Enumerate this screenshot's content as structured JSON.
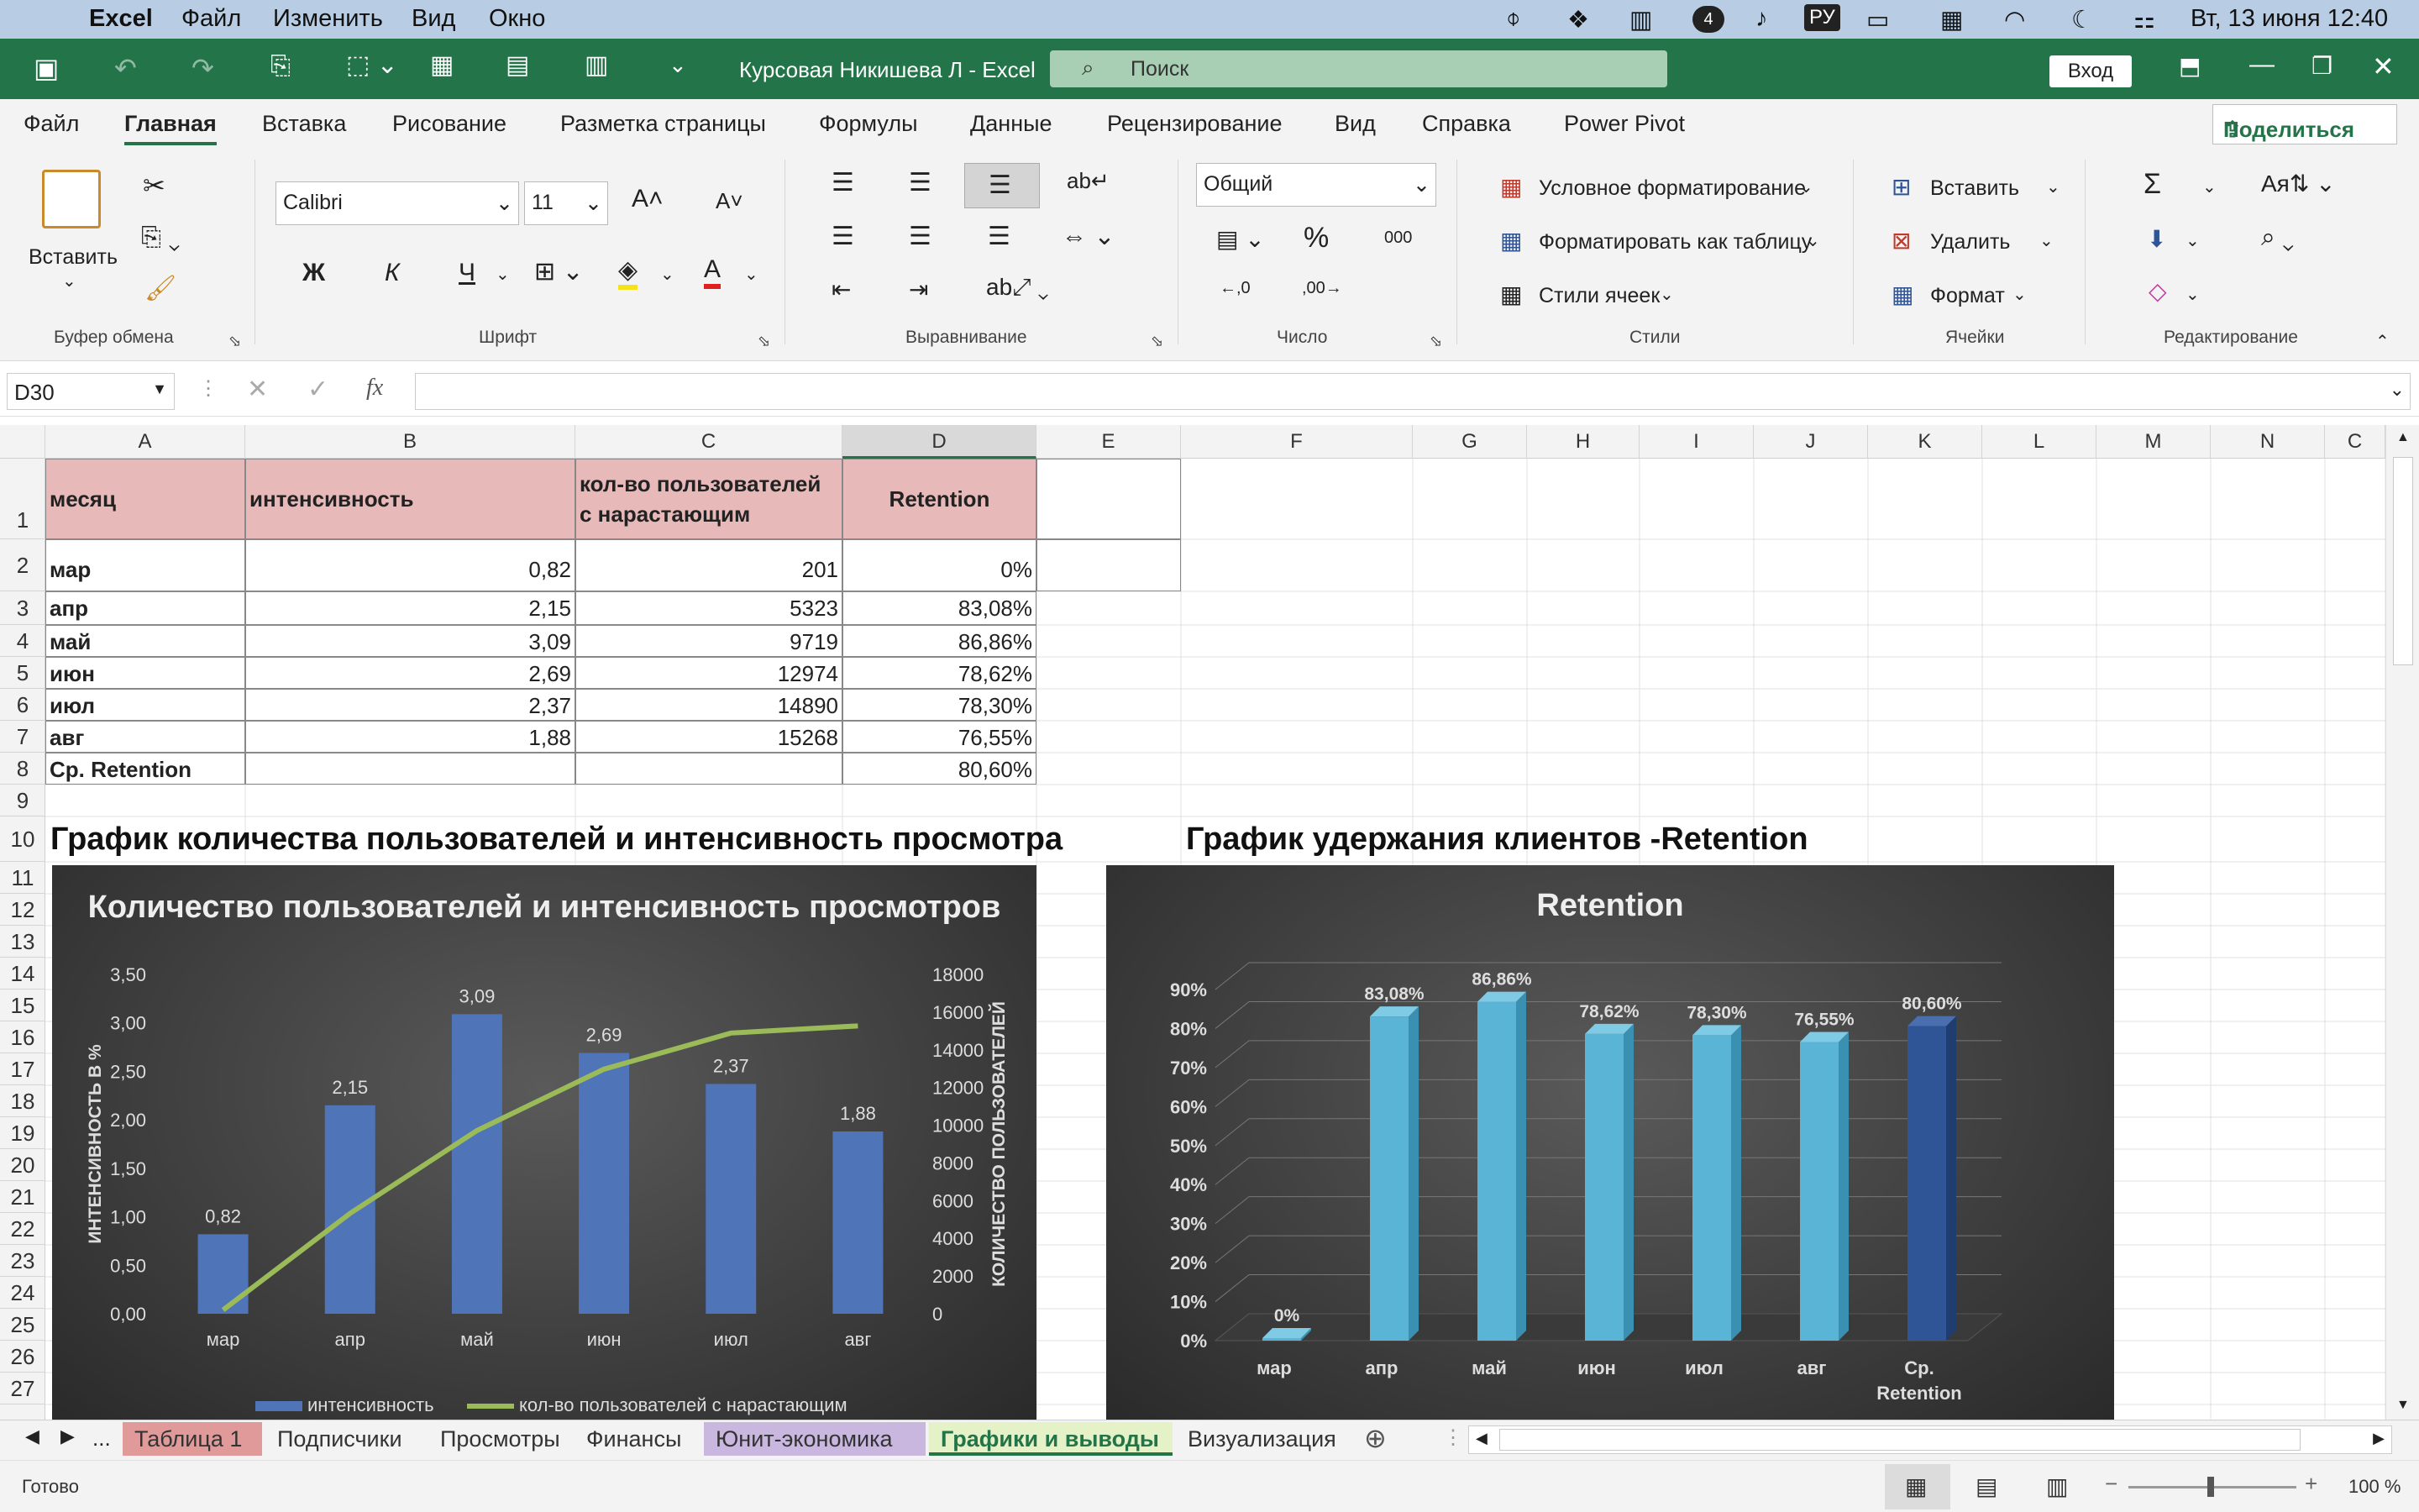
{
  "menubar": {
    "app": "Excel",
    "items": [
      "Файл",
      "Изменить",
      "Вид",
      "Окно"
    ],
    "lang": "РУ",
    "badge": "4",
    "datetime": "Вт, 13 июня  12:40"
  },
  "titlebar": {
    "doc_title": "Курсовая Никишева Л  -  Excel",
    "search_placeholder": "Поиск",
    "login": "Вход"
  },
  "ribbon_tabs": [
    "Файл",
    "Главная",
    "Вставка",
    "Рисование",
    "Разметка страницы",
    "Формулы",
    "Данные",
    "Рецензирование",
    "Вид",
    "Справка",
    "Power Pivot"
  ],
  "share": "Поделиться",
  "ribbon": {
    "paste": "Вставить",
    "clipboard_group": "Буфер обмена",
    "font_name": "Calibri",
    "font_size": "11",
    "font_group": "Шрифт",
    "bold": "Ж",
    "italic": "К",
    "underline": "Ч",
    "alignment_group": "Выравнивание",
    "number_format": "Общий",
    "number_group": "Число",
    "cond_format": "Условное форматирование",
    "format_table": "Форматировать как таблицу",
    "cell_styles": "Стили ячеек",
    "styles_group": "Стили",
    "insert": "Вставить",
    "delete": "Удалить",
    "format": "Формат",
    "cells_group": "Ячейки",
    "editing_group": "Редактирование"
  },
  "formula_bar": {
    "name_box": "D30",
    "fx": "fx",
    "value": ""
  },
  "columns": [
    "A",
    "B",
    "C",
    "D",
    "E",
    "F",
    "G",
    "H",
    "I",
    "J",
    "K",
    "L",
    "M",
    "N",
    "C"
  ],
  "rows": [
    "1",
    "2",
    "3",
    "4",
    "5",
    "6",
    "7",
    "8",
    "9",
    "10",
    "11",
    "12",
    "13",
    "14",
    "15",
    "16",
    "17",
    "18",
    "19",
    "20",
    "21",
    "22",
    "23",
    "24",
    "25",
    "26",
    "27"
  ],
  "table": {
    "headers": [
      "месяц",
      "интенсивность",
      "кол-во пользователей с нарастающим",
      "Retention"
    ],
    "rows": [
      [
        "мар",
        "0,82",
        "201",
        "0%"
      ],
      [
        "апр",
        "2,15",
        "5323",
        "83,08%"
      ],
      [
        "май",
        "3,09",
        "9719",
        "86,86%"
      ],
      [
        "июн",
        "2,69",
        "12974",
        "78,62%"
      ],
      [
        "июл",
        "2,37",
        "14890",
        "78,30%"
      ],
      [
        "авг",
        "1,88",
        "15268",
        "76,55%"
      ],
      [
        "Ср. Retention",
        "",
        "",
        "80,60%"
      ]
    ]
  },
  "heading1": "График количества пользователей и интенсивность просмотра",
  "heading2": "График удержания клиентов -Retention",
  "chart_data": [
    {
      "type": "bar",
      "title": "Количество пользователей и интенсивность просмотров",
      "categories": [
        "мар",
        "апр",
        "май",
        "июн",
        "июл",
        "авг"
      ],
      "series": [
        {
          "name": "интенсивность",
          "type": "bar",
          "axis": "left",
          "values": [
            0.82,
            2.15,
            3.09,
            2.69,
            2.37,
            1.88
          ],
          "labels": [
            "0,82",
            "2,15",
            "3,09",
            "2,69",
            "2,37",
            "1,88"
          ],
          "color": "#4f74b8"
        },
        {
          "name": "кол-во пользователей с нарастающим",
          "type": "line",
          "axis": "right",
          "values": [
            201,
            5323,
            9719,
            12974,
            14890,
            15268
          ],
          "color": "#9bbb59"
        }
      ],
      "ylabel": "ИНТЕНСИВНОСТЬ В %",
      "y2label": "КОЛИЧЕСТВО ПОЛЬЗОВАТЕЛЕЙ",
      "ylim": [
        0,
        3.5
      ],
      "y2lim": [
        0,
        18000
      ],
      "yticks": [
        "0,00",
        "0,50",
        "1,00",
        "1,50",
        "2,00",
        "2,50",
        "3,00",
        "3,50"
      ],
      "y2ticks": [
        "0",
        "2000",
        "4000",
        "6000",
        "8000",
        "10000",
        "12000",
        "14000",
        "16000",
        "18000"
      ],
      "legend_position": "bottom",
      "background": "#333333"
    },
    {
      "type": "bar",
      "title": "Retention",
      "categories": [
        "мар",
        "апр",
        "май",
        "июн",
        "июл",
        "авг",
        "Ср. Retention"
      ],
      "values": [
        0,
        83.08,
        86.86,
        78.62,
        78.3,
        76.55,
        80.6
      ],
      "labels": [
        "0%",
        "83,08%",
        "86,86%",
        "78,62%",
        "78,30%",
        "76,55%",
        "80,60%"
      ],
      "ylim": [
        0,
        90
      ],
      "yticks": [
        "0%",
        "10%",
        "20%",
        "30%",
        "40%",
        "50%",
        "60%",
        "70%",
        "80%",
        "90%"
      ],
      "color": "#5ab4d6",
      "highlight_color": "#2f5597",
      "style": "3d",
      "grid": true
    }
  ],
  "sheet_tabs": [
    {
      "label": "Таблица 1",
      "color": "#e09a9a"
    },
    {
      "label": "Подписчики",
      "color": ""
    },
    {
      "label": "Просмотры",
      "color": ""
    },
    {
      "label": "Финансы",
      "color": ""
    },
    {
      "label": "Юнит-экономика",
      "color": "#c9b7e0"
    },
    {
      "label": "Графики и выводы",
      "color": "#e5f2c8",
      "active": true
    },
    {
      "label": "Визуализация",
      "color": ""
    }
  ],
  "sheet_more": "...",
  "status": {
    "ready": "Готово",
    "zoom": "100 %"
  }
}
